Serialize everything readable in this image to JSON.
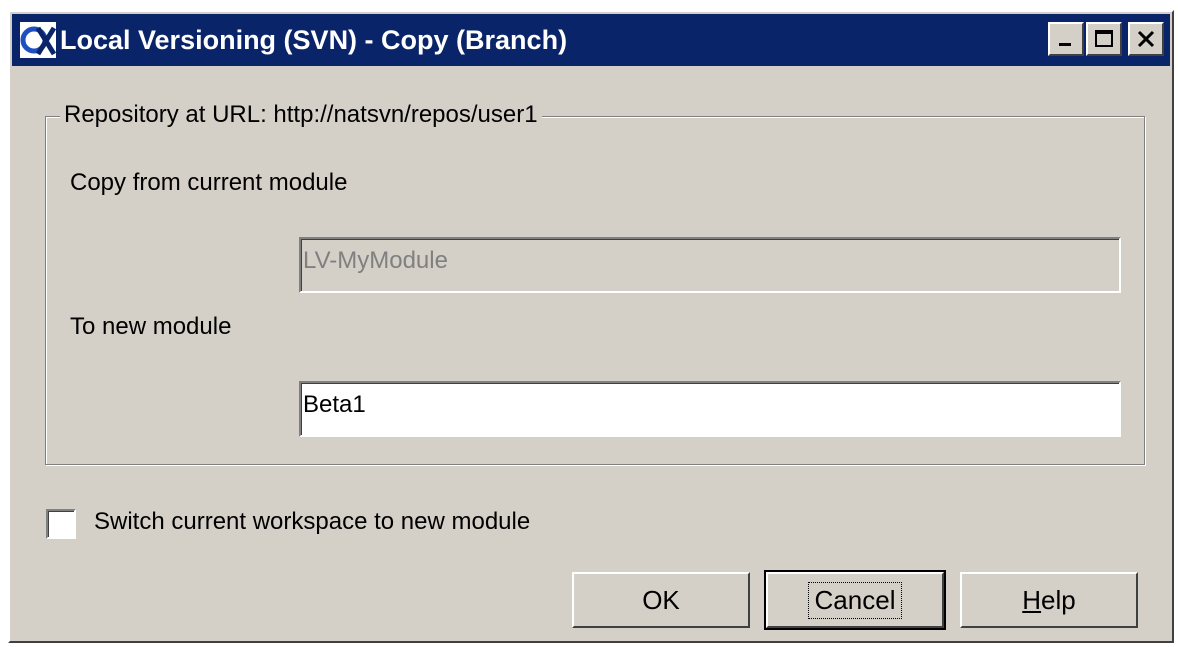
{
  "window": {
    "title": "Local Versioning (SVN) - Copy (Branch)",
    "controls": {
      "minimize": "_",
      "maximize": "□",
      "close": "✕"
    }
  },
  "group": {
    "legend": "Repository at URL: http://natsvn/repos/user1",
    "copy_from_label": "Copy from current module",
    "copy_from_value": "LV-MyModule",
    "to_new_label": "To new module",
    "to_new_value": "Beta1"
  },
  "options": {
    "switch_label": "Switch current workspace to new module",
    "switch_checked": false
  },
  "buttons": {
    "ok": "OK",
    "cancel": "Cancel",
    "help_mnemonic": "H",
    "help_rest": "elp"
  }
}
